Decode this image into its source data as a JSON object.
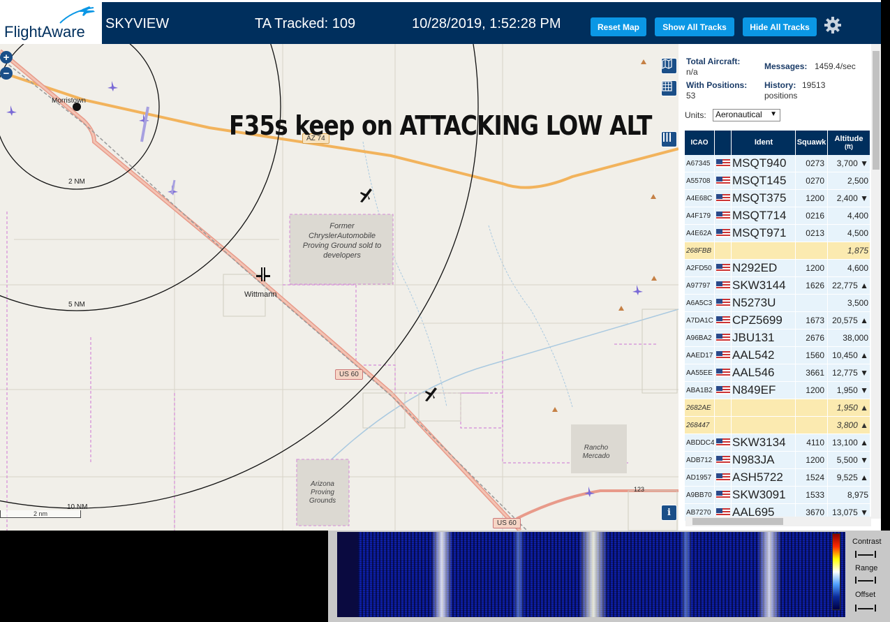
{
  "header": {
    "logo_text": "FlightAware",
    "app_name": "SKYVIEW",
    "tracked": "TA Tracked: 109",
    "datetime": "10/28/2019, 1:52:28 PM",
    "reset_map": "Reset Map",
    "show_all": "Show All Tracks",
    "hide_all": "Hide All Tracks"
  },
  "map": {
    "annotation": "F35s keep on ATTACKING LOW ALT",
    "places": {
      "morristown": "Morristown",
      "wittmann": "Wittmann",
      "proving_ground": "Former ChryslerAutomobile Proving Ground sold to developers",
      "arizona_proving": "Arizona Proving Grounds",
      "rancho": "Rancho Mercado"
    },
    "rings": [
      "2 NM",
      "5 NM",
      "10 NM"
    ],
    "roads": [
      "AZ 74",
      "US 60",
      "US 60",
      "123"
    ],
    "scale": "2 nm",
    "info": "i"
  },
  "panel": {
    "total_aircraft_label": "Total Aircraft:",
    "total_aircraft": "n/a",
    "messages_label": "Messages:",
    "messages": "1459.4/sec",
    "with_positions_label": "With Positions:",
    "with_positions": "53",
    "history_label": "History:",
    "history": "19513",
    "history_unit": "positions",
    "units_label": "Units:",
    "units_value": "Aeronautical"
  },
  "table": {
    "headers": {
      "icao": "ICAO",
      "ident": "Ident",
      "squawk": "Squawk",
      "altitude": "Altitude",
      "altitude_unit": "(ft)"
    },
    "rows": [
      {
        "icao": "A67345",
        "flag": true,
        "ident": "MSQT940",
        "squawk": "0273",
        "alt": "3,700 ▼",
        "nopos": false
      },
      {
        "icao": "A55708",
        "flag": true,
        "ident": "MSQT145",
        "squawk": "0270",
        "alt": "2,500",
        "nopos": false
      },
      {
        "icao": "A4E68C",
        "flag": true,
        "ident": "MSQT375",
        "squawk": "1200",
        "alt": "2,400 ▼",
        "nopos": false
      },
      {
        "icao": "A4F179",
        "flag": true,
        "ident": "MSQT714",
        "squawk": "0216",
        "alt": "4,400",
        "nopos": false
      },
      {
        "icao": "A4E62A",
        "flag": true,
        "ident": "MSQT971",
        "squawk": "0213",
        "alt": "4,500",
        "nopos": false
      },
      {
        "icao": "268FBB",
        "flag": false,
        "ident": "",
        "squawk": "",
        "alt": "1,875",
        "nopos": true
      },
      {
        "icao": "A2FD50",
        "flag": true,
        "ident": "N292ED",
        "squawk": "1200",
        "alt": "4,600",
        "nopos": false
      },
      {
        "icao": "A97797",
        "flag": true,
        "ident": "SKW3144",
        "squawk": "1626",
        "alt": "22,775 ▲",
        "nopos": false
      },
      {
        "icao": "A6A5C3",
        "flag": true,
        "ident": "N5273U",
        "squawk": "",
        "alt": "3,500",
        "nopos": false
      },
      {
        "icao": "A7DA1C",
        "flag": true,
        "ident": "CPZ5699",
        "squawk": "1673",
        "alt": "20,575 ▲",
        "nopos": false
      },
      {
        "icao": "A96BA2",
        "flag": true,
        "ident": "JBU131",
        "squawk": "2676",
        "alt": "38,000",
        "nopos": false
      },
      {
        "icao": "AAED17",
        "flag": true,
        "ident": "AAL542",
        "squawk": "1560",
        "alt": "10,450 ▲",
        "nopos": false
      },
      {
        "icao": "AA55EE",
        "flag": true,
        "ident": "AAL546",
        "squawk": "3661",
        "alt": "12,775 ▼",
        "nopos": false
      },
      {
        "icao": "ABA1B2",
        "flag": true,
        "ident": "N849EF",
        "squawk": "1200",
        "alt": "1,950 ▼",
        "nopos": false
      },
      {
        "icao": "2682AE",
        "flag": false,
        "ident": "",
        "squawk": "",
        "alt": "1,950 ▲",
        "nopos": true
      },
      {
        "icao": "268447",
        "flag": false,
        "ident": "",
        "squawk": "",
        "alt": "3,800 ▲",
        "nopos": true
      },
      {
        "icao": "ABDDC4",
        "flag": true,
        "ident": "SKW3134",
        "squawk": "4110",
        "alt": "13,100 ▲",
        "nopos": false
      },
      {
        "icao": "ADB712",
        "flag": true,
        "ident": "N983JA",
        "squawk": "1200",
        "alt": "5,500 ▼",
        "nopos": false
      },
      {
        "icao": "AD1957",
        "flag": true,
        "ident": "ASH5722",
        "squawk": "1524",
        "alt": "9,525 ▲",
        "nopos": false
      },
      {
        "icao": "A9BB70",
        "flag": true,
        "ident": "SKW3091",
        "squawk": "1533",
        "alt": "8,975",
        "nopos": false
      },
      {
        "icao": "AB7270",
        "flag": true,
        "ident": "AAL695",
        "squawk": "3670",
        "alt": "13,075 ▼",
        "nopos": false
      }
    ]
  },
  "spectrum": {
    "contrast": "Contrast",
    "range": "Range",
    "offset": "Offset"
  },
  "colors": {
    "header_bg": "#002f5d",
    "button_bg": "#0b97e5",
    "row_bg": "#e7f3fb",
    "nopos_row_bg": "#fbeab0"
  }
}
